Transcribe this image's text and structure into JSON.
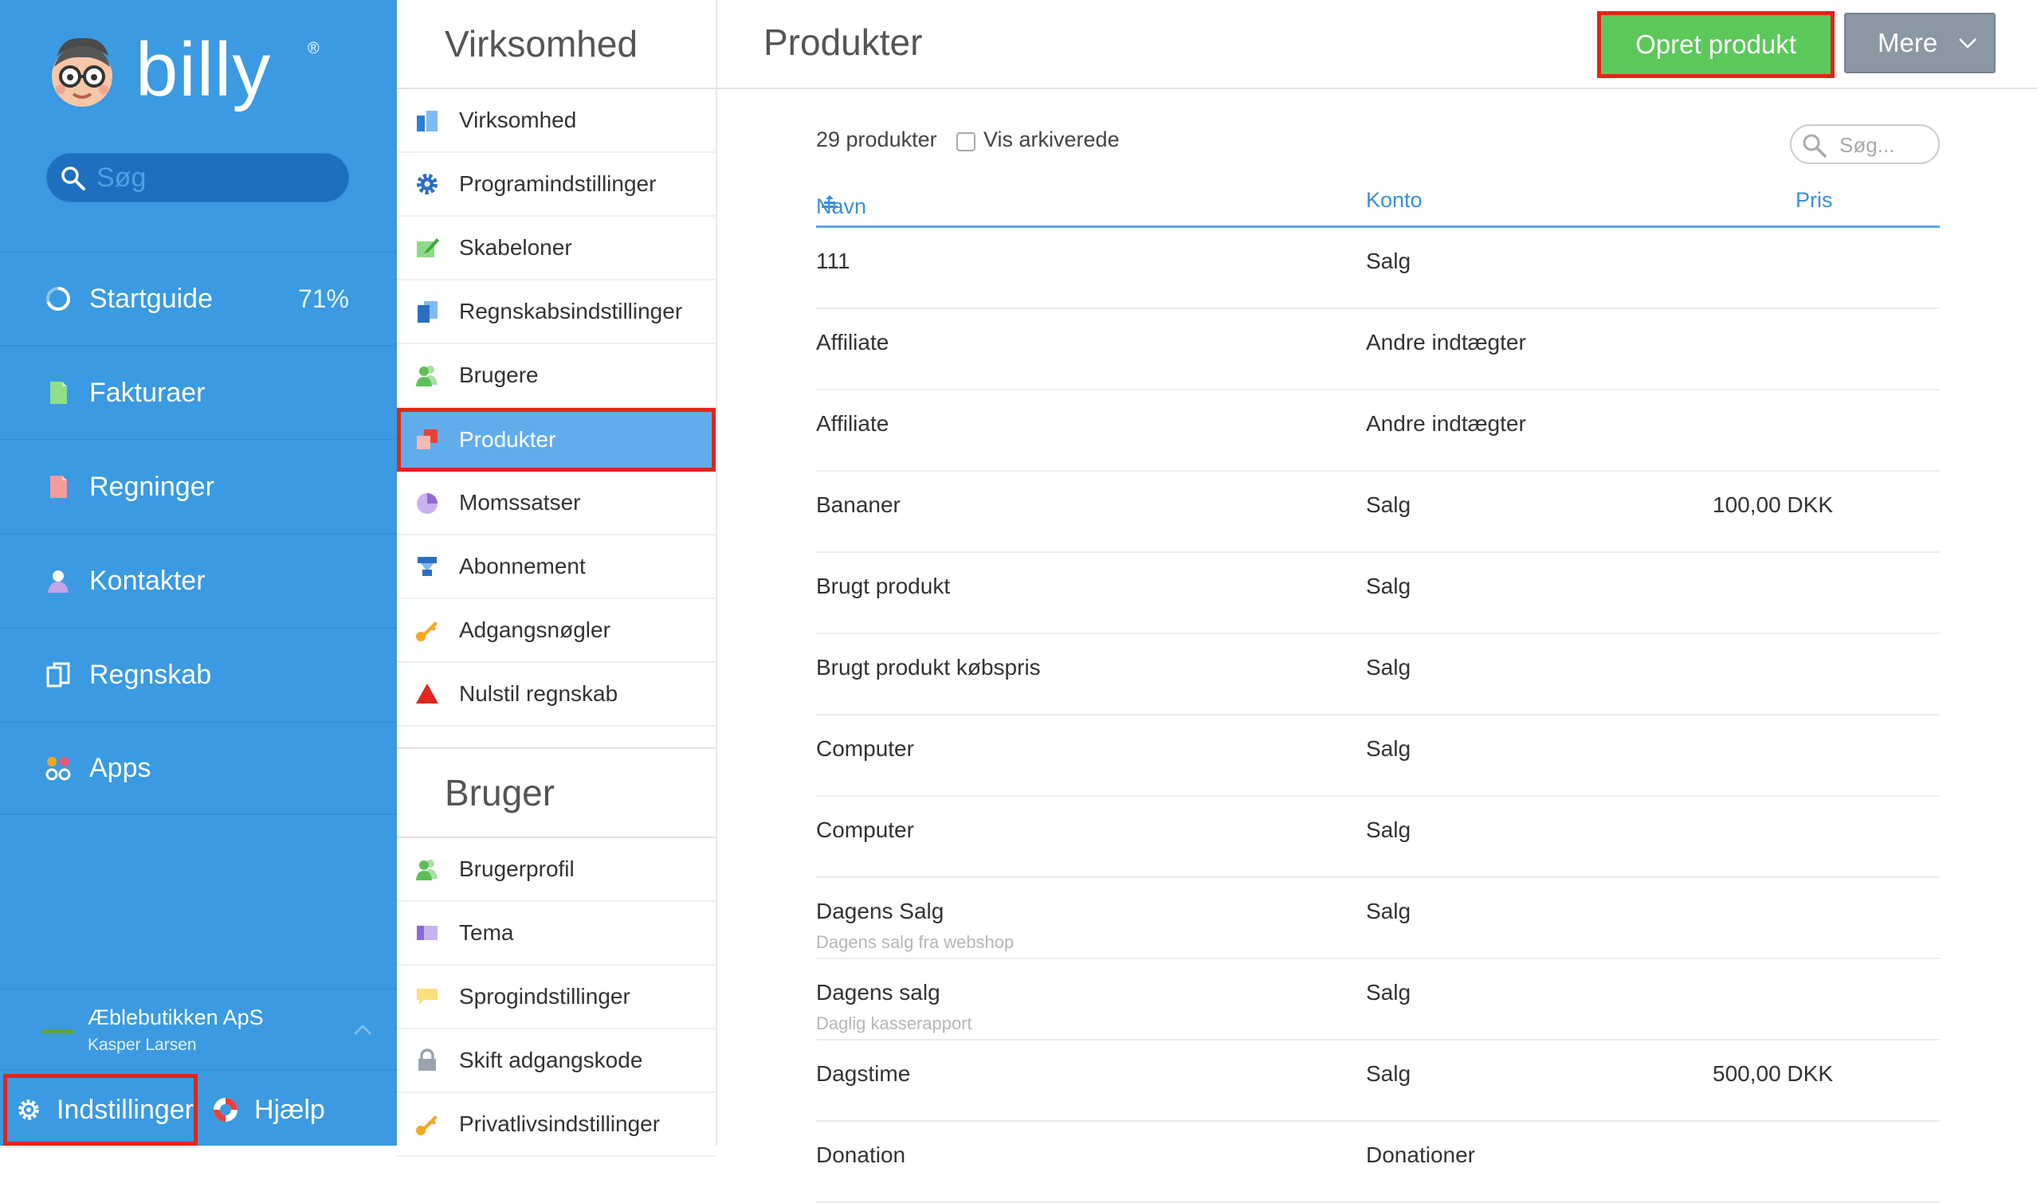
{
  "brand": {
    "name": "billy",
    "mark": "®"
  },
  "sidebar": {
    "search_placeholder": "Søg",
    "items": [
      {
        "label": "Startguide",
        "badge": "71%",
        "icon": "progress-ring-icon"
      },
      {
        "label": "Fakturaer",
        "icon": "invoice-icon"
      },
      {
        "label": "Regninger",
        "icon": "bill-icon"
      },
      {
        "label": "Kontakter",
        "icon": "person-icon"
      },
      {
        "label": "Regnskab",
        "icon": "ledger-icon"
      },
      {
        "label": "Apps",
        "icon": "apps-icon"
      }
    ],
    "company": {
      "name": "Æblebutikken ApS",
      "user": "Kasper Larsen"
    },
    "settings_label": "Indstillinger",
    "help_label": "Hjælp"
  },
  "settings_menu": {
    "company_title": "Virksomhed",
    "company_items": [
      {
        "label": "Virksomhed",
        "icon": "building-icon"
      },
      {
        "label": "Programindstillinger",
        "icon": "gear-icon"
      },
      {
        "label": "Skabeloner",
        "icon": "template-icon"
      },
      {
        "label": "Regnskabsindstillinger",
        "icon": "accounting-icon"
      },
      {
        "label": "Brugere",
        "icon": "users-icon"
      },
      {
        "label": "Produkter",
        "icon": "products-icon",
        "active": true
      },
      {
        "label": "Momssatser",
        "icon": "pie-icon"
      },
      {
        "label": "Abonnement",
        "icon": "subscription-icon"
      },
      {
        "label": "Adgangsnøgler",
        "icon": "key-icon"
      },
      {
        "label": "Nulstil regnskab",
        "icon": "warning-icon"
      }
    ],
    "user_title": "Bruger",
    "user_items": [
      {
        "label": "Brugerprofil",
        "icon": "users-icon"
      },
      {
        "label": "Tema",
        "icon": "theme-icon"
      },
      {
        "label": "Sprogindstillinger",
        "icon": "speech-icon"
      },
      {
        "label": "Skift adgangskode",
        "icon": "lock-icon"
      },
      {
        "label": "Privatlivsindstillinger",
        "icon": "key-icon"
      }
    ]
  },
  "main": {
    "title": "Produkter",
    "create_label": "Opret produkt",
    "more_label": "Mere",
    "count_label": "29 produkter",
    "archived_label": "Vis arkiverede",
    "search_placeholder": "Søg...",
    "columns": {
      "name": "Navn",
      "account": "Konto",
      "price": "Pris"
    },
    "rows": [
      {
        "name": "111",
        "account": "Salg",
        "price": "",
        "desc": ""
      },
      {
        "name": "Affiliate",
        "account": "Andre indtægter",
        "price": "",
        "desc": ""
      },
      {
        "name": "Affiliate",
        "account": "Andre indtægter",
        "price": "",
        "desc": ""
      },
      {
        "name": "Bananer",
        "account": "Salg",
        "price": "100,00 DKK",
        "desc": ""
      },
      {
        "name": "Brugt produkt",
        "account": "Salg",
        "price": "",
        "desc": ""
      },
      {
        "name": "Brugt produkt købspris",
        "account": "Salg",
        "price": "",
        "desc": ""
      },
      {
        "name": "Computer",
        "account": "Salg",
        "price": "",
        "desc": ""
      },
      {
        "name": "Computer",
        "account": "Salg",
        "price": "",
        "desc": ""
      },
      {
        "name": "Dagens Salg",
        "account": "Salg",
        "price": "",
        "desc": "Dagens salg fra webshop"
      },
      {
        "name": "Dagens salg",
        "account": "Salg",
        "price": "",
        "desc": "Daglig kasserapport"
      },
      {
        "name": "Dagstime",
        "account": "Salg",
        "price": "500,00 DKK",
        "desc": ""
      },
      {
        "name": "Donation",
        "account": "Donationer",
        "price": "",
        "desc": ""
      }
    ]
  },
  "colors": {
    "sidebar_bg": "#3b9ae1",
    "active_item": "#61adeb",
    "create_button": "#5cc85a",
    "more_button": "#8b97a3",
    "highlight_border": "#e0261b",
    "table_header": "#3b8fdb"
  }
}
